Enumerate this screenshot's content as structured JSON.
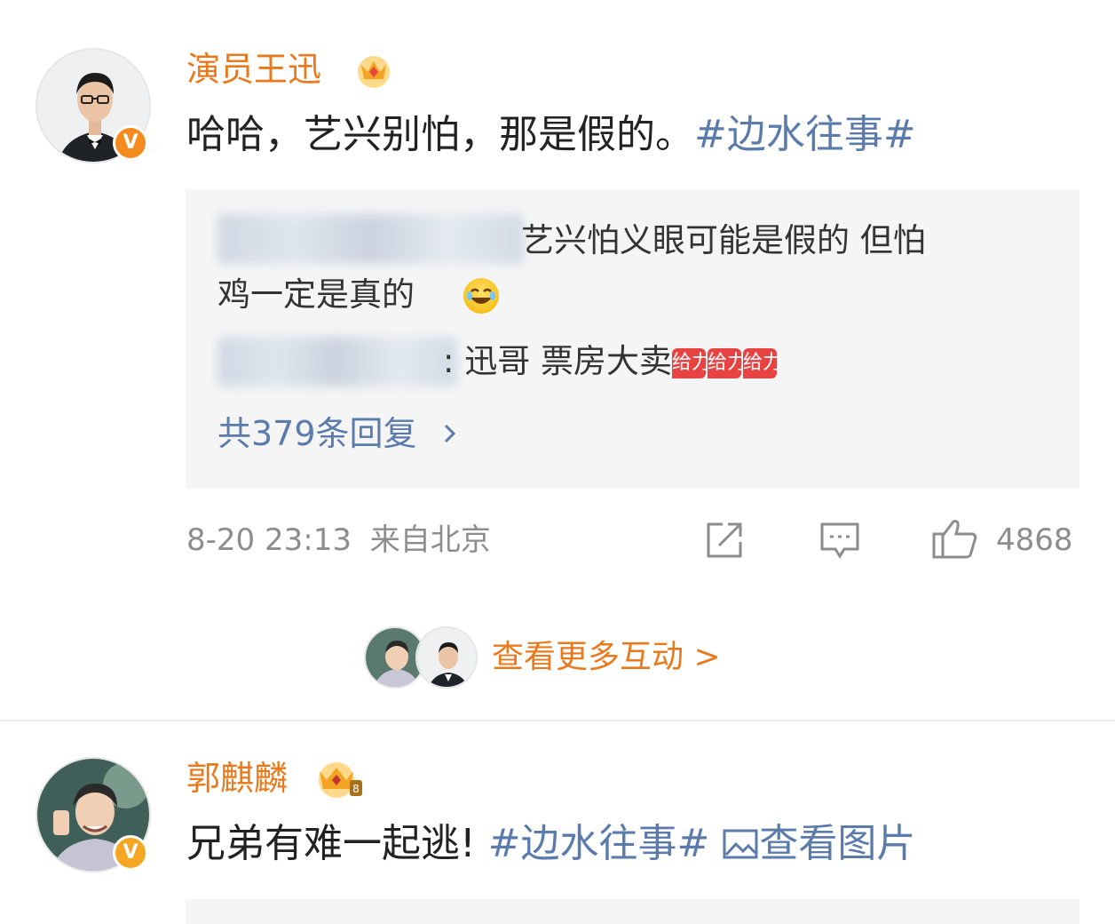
{
  "comments": [
    {
      "author": "演员王迅",
      "text": "哈哈，艺兴别怕，那是假的。",
      "topic": "#边水往事#",
      "replies": [
        {
          "text_line1": "艺兴怕义眼可能是假的 但怕",
          "text_line2": "鸡一定是真的"
        },
        {
          "separator": ":",
          "text": "迅哥 票房大卖",
          "emoji_text": "给力"
        }
      ],
      "reply_count_label": "共379条回复",
      "time": "8-20 23:13",
      "location": "来自北京",
      "like_count": "4868"
    },
    {
      "author": "郭麒麟",
      "text": "兄弟有难一起逃!",
      "topic": "#边水往事#",
      "image_link": "查看图片"
    }
  ],
  "more_interactions_label": "查看更多互动 >",
  "colors": {
    "name": "#e87a1d",
    "link": "#5b7bab",
    "meta": "#8d8d8d",
    "reply_bg": "#f5f5f5"
  }
}
